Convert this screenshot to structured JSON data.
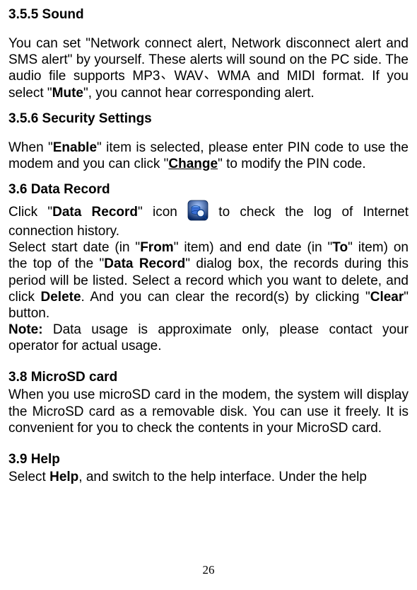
{
  "sections": {
    "sound": {
      "heading": "3.5.5 Sound",
      "p1a": "You can set \"Network connect alert, Network disconnect alert and SMS alert\" by yourself. These alerts will sound on the PC side. The audio file supports MP3",
      "sep1": "、",
      "p1b": "WAV",
      "sep2": "、",
      "p1c": "WMA and MIDI format. If you select \"",
      "mute": "Mute",
      "p1d": "\", you cannot hear corresponding alert."
    },
    "security": {
      "heading": "3.5.6 Security Settings",
      "p1a": "When \"",
      "enable": "Enable",
      "p1b": "\" item is selected, please enter PIN code to use the modem and you can click \"",
      "change": "Change",
      "p1c": "\" to modify the PIN code."
    },
    "dataRecord": {
      "heading": "3.6 Data Record",
      "p1a": "Click \"",
      "dr": "Data Record",
      "p1b": "\" icon ",
      "p1c": " to check the log of Internet connection history.",
      "p2a": "Select start date (in \"",
      "from": "From",
      "p2b": "\" item) and end date (in \"",
      "to": "To",
      "p2c": "\" item) on the top of the \"",
      "dr2": "Data Record",
      "p2d": "\" dialog box, the records during this period will be listed. Select a record which you want to delete, and click ",
      "delete": "Delete",
      "p2e": ". And you can clear the record(s) by clicking \"",
      "clear": "Clear",
      "p2f": "\" button.",
      "noteLabel": "Note:",
      "note": " Data usage is approximate only, please contact your operator for actual usage."
    },
    "microsd": {
      "heading": "3.8 MicroSD card",
      "p1": "When you use microSD card in the modem, the system will display the MicroSD card as a removable disk. You can use it freely. It is convenient for you to check the contents in your MicroSD card."
    },
    "help": {
      "heading": "3.9 Help",
      "p1a": "Select ",
      "help": "Help",
      "p1b": ", and switch to the help interface. Under the help"
    }
  },
  "icon": {
    "name": "data-record-icon"
  },
  "pageNumber": "26"
}
